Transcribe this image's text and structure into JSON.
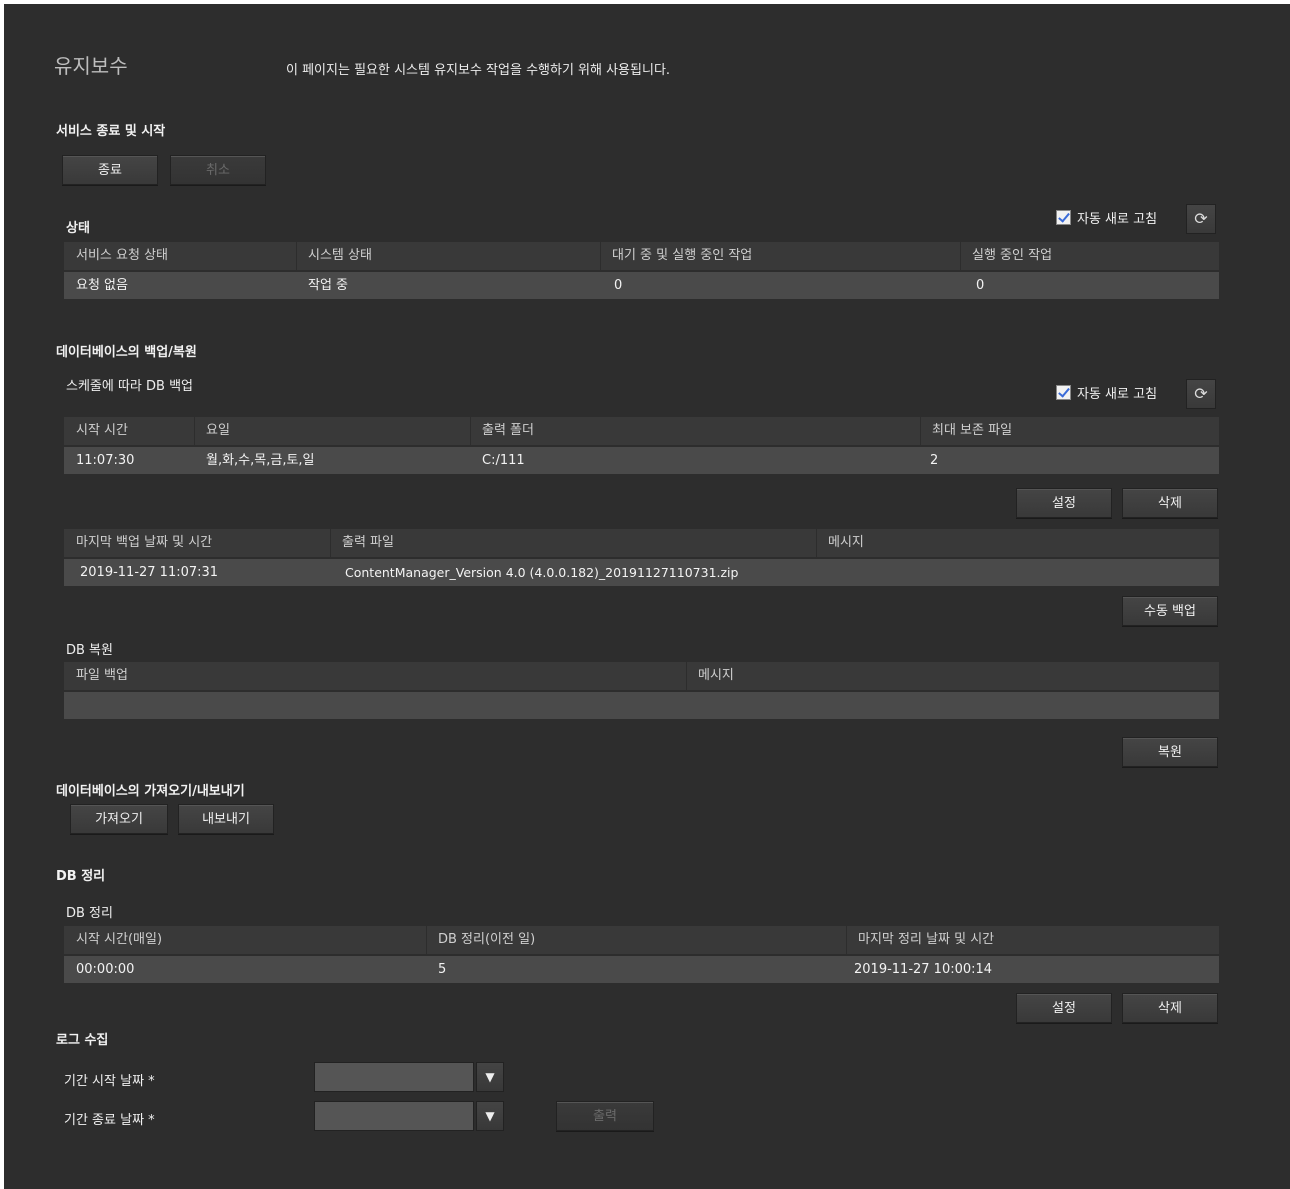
{
  "header": {
    "title": "유지보수",
    "description": "이 페이지는 필요한 시스템 유지보수 작업을 수행하기 위해 사용됩니다."
  },
  "service": {
    "title": "서비스 종료 및 시작",
    "stop_label": "종료",
    "cancel_label": "취소"
  },
  "status": {
    "title": "상태",
    "auto_refresh_label": "자동 새로 고침",
    "columns": [
      "서비스 요청 상태",
      "시스템 상태",
      "대기 중 및 실행 중인 작업",
      "실행 중인 작업"
    ],
    "row": [
      "요청 없음",
      "작업 중",
      "0",
      "0"
    ]
  },
  "backup": {
    "title": "데이터베이스의 백업/복원",
    "schedule_title": "스케줄에 따라 DB 백업",
    "auto_refresh_label": "자동 새로 고침",
    "schedule_columns": [
      "시작 시간",
      "요일",
      "출력 폴더",
      "최대 보존 파일"
    ],
    "schedule_row": [
      "11:07:30",
      "월,화,수,목,금,토,일",
      "C:/111",
      "2"
    ],
    "set_label": "설정",
    "delete_label": "삭제",
    "last_columns": [
      "마지막 백업 날짜 및 시간",
      "출력 파일",
      "메시지"
    ],
    "last_row": [
      "2019-11-27 11:07:31",
      "ContentManager_Version 4.0 (4.0.0.182)_20191127110731.zip",
      ""
    ],
    "manual_backup_label": "수동 백업",
    "restore_title": "DB 복원",
    "restore_columns": [
      "파일 백업",
      "메시지"
    ],
    "restore_label": "복원"
  },
  "import_export": {
    "title": "데이터베이스의 가져오기/내보내기",
    "import_label": "가져오기",
    "export_label": "내보내기"
  },
  "cleanup": {
    "title": "DB 정리",
    "sub_title": "DB 정리",
    "columns": [
      "시작 시간(매일)",
      "DB 정리(이전 일)",
      "마지막 정리 날짜 및 시간"
    ],
    "row": [
      "00:00:00",
      "5",
      "2019-11-27 10:00:14"
    ],
    "set_label": "설정",
    "delete_label": "삭제"
  },
  "logs": {
    "title": "로그 수집",
    "start_label": "기간 시작 날짜 *",
    "end_label": "기간 종료 날짜 *",
    "output_label": "출력"
  },
  "icons": {
    "refresh": "refresh-icon",
    "checkbox": "checkmark-icon",
    "dropdown": "caret-down-icon"
  }
}
